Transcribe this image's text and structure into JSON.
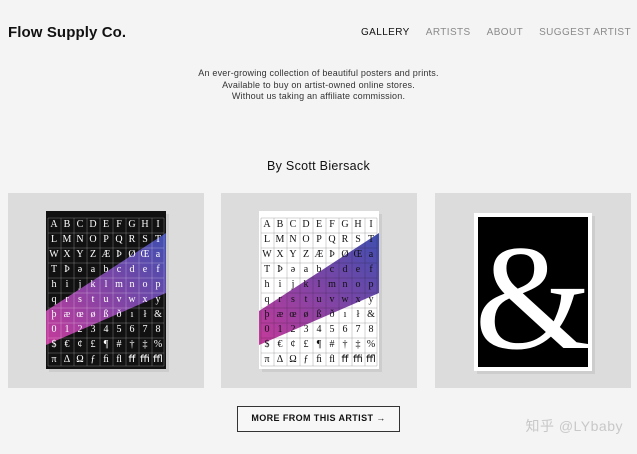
{
  "brand": {
    "name": "Flow Supply Co."
  },
  "nav": {
    "gallery": "GALLERY",
    "artists": "ARTISTS",
    "about": "ABOUT",
    "suggest": "SUGGEST ARTIST"
  },
  "intro": {
    "line1": "An ever-growing collection of beautiful posters and prints.",
    "line2": "Available to buy on artist-owned online stores.",
    "line3": "Without us taking an affiliate commission."
  },
  "artist_heading": "By Scott Biersack",
  "posters": [
    {
      "variant": "dark-letter-grid",
      "colors": [
        "#3e4fb0",
        "#c43a9a"
      ]
    },
    {
      "variant": "light-letter-grid",
      "colors": [
        "#3e4fb0",
        "#c43a9a"
      ]
    },
    {
      "variant": "ampersand",
      "colors": [
        "#000000",
        "#ffffff"
      ],
      "glyph": "&"
    }
  ],
  "more_button": {
    "label": "MORE FROM THIS ARTIST →"
  },
  "watermark": "知乎 @LYbaby"
}
